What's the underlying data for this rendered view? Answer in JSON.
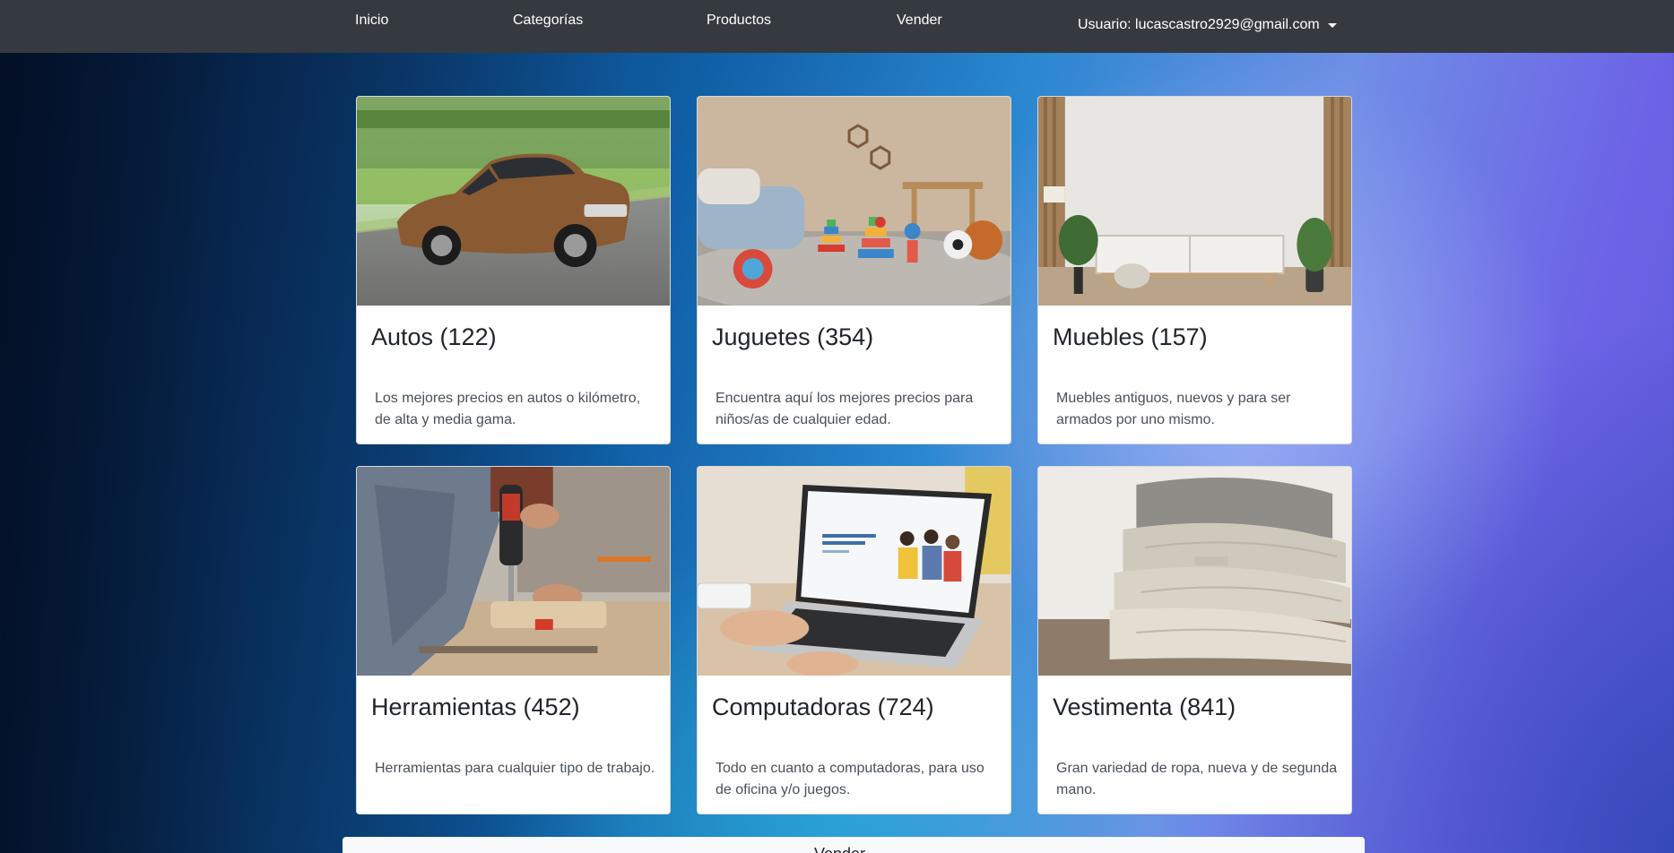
{
  "navbar": {
    "items": [
      {
        "label": "Inicio"
      },
      {
        "label": "Categorías"
      },
      {
        "label": "Productos"
      },
      {
        "label": "Vender"
      }
    ],
    "user_label": "Usuario: lucascastro2929@gmail.com"
  },
  "cards": [
    {
      "title": "Autos (122)",
      "text": "Los mejores precios en autos o kilómetro, de alta y media gama.",
      "image": "car-photo"
    },
    {
      "title": "Juguetes (354)",
      "text": "Encuentra aquí los mejores precios para niños/as de cualquier edad.",
      "image": "toys-photo"
    },
    {
      "title": "Muebles (157)",
      "text": "Muebles antiguos, nuevos y para ser armados por uno mismo.",
      "image": "furniture-photo"
    },
    {
      "title": "Herramientas (452)",
      "text": "Herramientas para cualquier tipo de trabajo.",
      "image": "tools-photo"
    },
    {
      "title": "Computadoras (724)",
      "text": "Todo en cuanto a computadoras, para uso de oficina y/o juegos.",
      "image": "laptop-photo"
    },
    {
      "title": "Vestimenta (841)",
      "text": "Gran variedad de ropa, nueva y de segunda mano.",
      "image": "clothes-photo"
    }
  ],
  "footer_partial": {
    "label": "Vender"
  },
  "colors": {
    "navbar": "#343a40",
    "card_bg": "#ffffff",
    "title_text": "#212529",
    "body_text": "#495057"
  }
}
